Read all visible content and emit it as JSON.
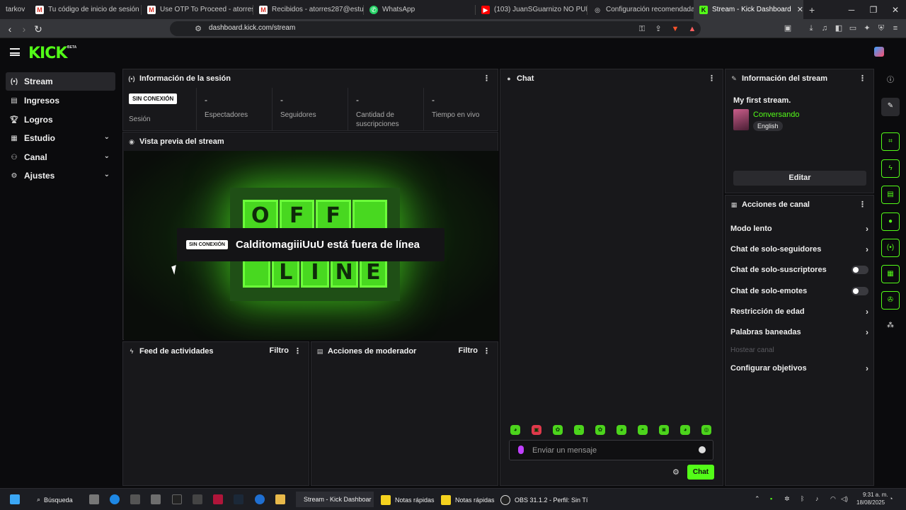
{
  "browser": {
    "tabs": [
      {
        "label": "tarkov",
        "active": false
      },
      {
        "label": "Tu código de inicio de sesión en d",
        "active": false
      },
      {
        "label": "Use OTP To Proceed - atorresuwu2",
        "active": false
      },
      {
        "label": "Recibidos - atorres287@estudiant",
        "active": false
      },
      {
        "label": "WhatsApp",
        "active": false
      },
      {
        "label": "(103) JuanSGuarnizo NO PUEDE C",
        "active": false
      },
      {
        "label": "Configuración recomendada Valor",
        "active": false
      },
      {
        "label": "Stream - Kick Dashboard",
        "active": true
      }
    ],
    "new_tab": "+",
    "url": "dashboard.kick.com/stream",
    "ext_badge_1": "9",
    "ext_badge_2": "1"
  },
  "header": {
    "logo": "KICK",
    "logo_badge": "BETA"
  },
  "sidebar": {
    "items": [
      {
        "label": "Stream",
        "icon": "broadcast-icon",
        "active": true,
        "expandable": false
      },
      {
        "label": "Ingresos",
        "icon": "income-icon",
        "active": false,
        "expandable": false
      },
      {
        "label": "Logros",
        "icon": "trophy-icon",
        "active": false,
        "expandable": false
      },
      {
        "label": "Estudio",
        "icon": "studio-icon",
        "active": false,
        "expandable": true
      },
      {
        "label": "Canal",
        "icon": "channel-icon",
        "active": false,
        "expandable": true
      },
      {
        "label": "Ajustes",
        "icon": "gear-icon",
        "active": false,
        "expandable": true
      }
    ]
  },
  "session": {
    "title": "Información de la sesión",
    "status_badge": "SIN CONEXIÓN",
    "stats": [
      {
        "label": "Sesión",
        "value": ""
      },
      {
        "label": "Espectadores",
        "value": "-"
      },
      {
        "label": "Seguidores",
        "value": "-"
      },
      {
        "label": "Cantidad de suscripciones",
        "value": "-"
      },
      {
        "label": "Tiempo en vivo",
        "value": "-"
      }
    ]
  },
  "preview": {
    "title": "Vista previa del stream",
    "sign_top": [
      "O",
      "F",
      "F",
      ""
    ],
    "sign_bottom": [
      "",
      "L",
      "I",
      "N",
      "E"
    ],
    "badge": "SIN CONEXIÓN",
    "message": "CalditomagiiiUuU está fuera de línea"
  },
  "activity": {
    "title": "Feed de actividades",
    "filter": "Filtro"
  },
  "mod": {
    "title": "Acciones de moderador",
    "filter": "Filtro"
  },
  "chat": {
    "title": "Chat",
    "placeholder": "Enviar un mensaje",
    "send_label": "Chat",
    "emote_count": 10
  },
  "stream_info": {
    "title": "Información del stream",
    "stream_title": "My first stream.",
    "category": "Conversando",
    "language": "English",
    "edit_label": "Editar"
  },
  "channel_actions": {
    "title": "Acciones de canal",
    "rows": [
      {
        "label": "Modo lento",
        "kind": "chevron"
      },
      {
        "label": "Chat de solo-seguidores",
        "kind": "chevron"
      },
      {
        "label": "Chat de solo-suscriptores",
        "kind": "toggle"
      },
      {
        "label": "Chat de solo-emotes",
        "kind": "toggle"
      },
      {
        "label": "Restricción de edad",
        "kind": "chevron"
      },
      {
        "label": "Palabras baneadas",
        "kind": "chevron"
      },
      {
        "label": "Hostear canal",
        "kind": "disabled"
      },
      {
        "label": "Configurar objetivos",
        "kind": "chevron"
      }
    ]
  },
  "taskbar": {
    "search": "Búsqueda",
    "apps": [
      {
        "label": "Stream - Kick Dashboar"
      },
      {
        "label": "Notas rápidas"
      },
      {
        "label": "Notas rápidas"
      },
      {
        "label": "OBS 31.1.2 - Perfil: Sin Tí"
      }
    ],
    "time": "9:31 a. m.",
    "date": "18/08/2025"
  },
  "colors": {
    "brand": "#53fc18",
    "panel": "#18181b",
    "bg": "#0b0b0d"
  }
}
